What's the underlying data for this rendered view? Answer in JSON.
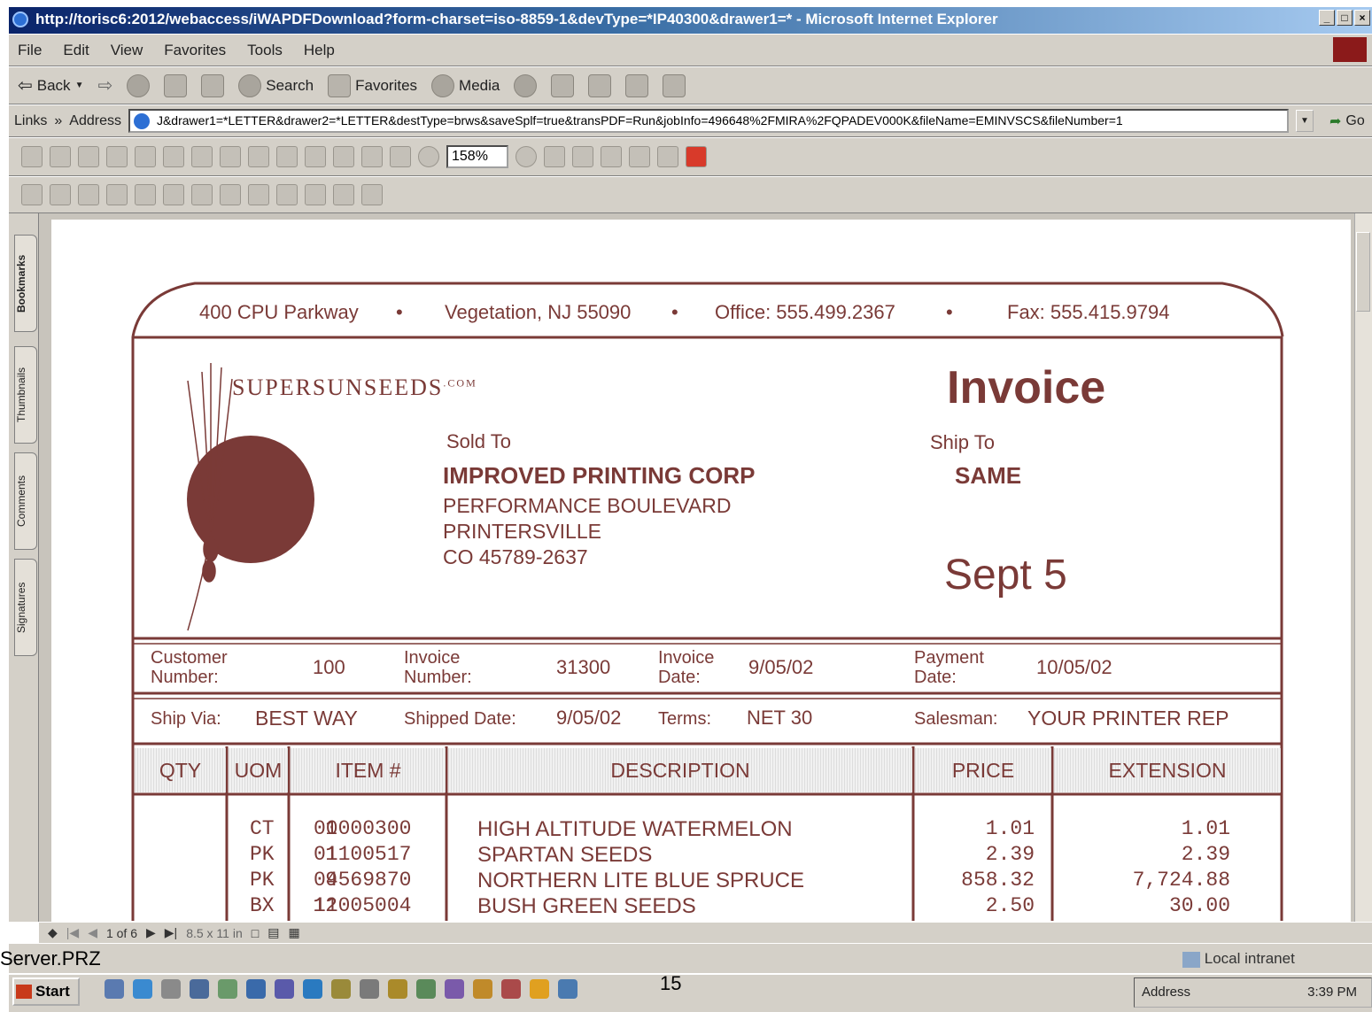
{
  "window": {
    "title": "http://torisc6:2012/webaccess/iWAPDFDownload?form-charset=iso-8859-1&devType=*IP40300&drawer1=* - Microsoft Internet Explorer",
    "buttons": [
      "_",
      "□",
      "×"
    ]
  },
  "menu": [
    "File",
    "Edit",
    "View",
    "Favorites",
    "Tools",
    "Help"
  ],
  "toolbar": {
    "back": "Back",
    "search": "Search",
    "favorites": "Favorites",
    "media": "Media"
  },
  "address": {
    "links_label": "Links",
    "chevron": "»",
    "label": "Address",
    "value": "J&drawer1=*LETTER&drawer2=*LETTER&destType=brws&saveSplf=true&transPDF=Run&jobInfo=496648%2FMIRA%2FQPADEV000K&fileName=EMINVSCS&fileNumber=1",
    "go": "Go"
  },
  "acrobat": {
    "zoom": "158%",
    "tabs": [
      "Bookmarks",
      "Thumbnails",
      "Comments",
      "Signatures"
    ],
    "page_indicator": "1 of 6",
    "page_size": "8.5 x 11 in"
  },
  "invoice": {
    "header_address": "400 CPU Parkway",
    "header_city": "Vegetation, NJ 55090",
    "header_office": "Office:  555.499.2367",
    "header_fax": "Fax:  555.415.9794",
    "bullet": "•",
    "logo_text": "SUPERSUNSEEDS",
    "logo_suffix": ".COM",
    "title": "Invoice",
    "sold_to_label": "Sold To",
    "sold_to_name": "IMPROVED PRINTING CORP",
    "sold_to_line1": "PERFORMANCE BOULEVARD",
    "sold_to_line2": "PRINTERSVILLE",
    "sold_to_line3": "CO  45789-2637",
    "ship_to_label": "Ship To",
    "ship_to_value": "SAME",
    "date_large": "Sept 5",
    "customer_number_label_1": "Customer",
    "customer_number_label_2": "Number:",
    "customer_number": "100",
    "invoice_number_label_1": "Invoice",
    "invoice_number_label_2": "Number:",
    "invoice_number": "31300",
    "invoice_date_label_1": "Invoice",
    "invoice_date_label_2": "Date:",
    "invoice_date": "9/05/02",
    "payment_date_label_1": "Payment",
    "payment_date_label_2": "Date:",
    "payment_date": "10/05/02",
    "ship_via_label": "Ship Via:",
    "ship_via": "BEST WAY",
    "shipped_date_label": "Shipped Date:",
    "shipped_date": "9/05/02",
    "terms_label": "Terms:",
    "terms": "NET 30",
    "salesman_label": "Salesman:",
    "salesman": "YOUR PRINTER REP",
    "columns": [
      "QTY",
      "UOM",
      "ITEM #",
      "DESCRIPTION",
      "PRICE",
      "EXTENSION"
    ],
    "rows": [
      {
        "qty": "1",
        "uom": "CT",
        "item": "00000300",
        "desc": "HIGH ALTITUDE WATERMELON",
        "price": "1.01",
        "ext": "1.01"
      },
      {
        "qty": "1",
        "uom": "PK",
        "item": "01100517",
        "desc": "SPARTAN SEEDS",
        "price": "2.39",
        "ext": "2.39"
      },
      {
        "qty": "9",
        "uom": "PK",
        "item": "04569870",
        "desc": "NORTHERN LITE BLUE SPRUCE",
        "price": "858.32",
        "ext": "7,724.88"
      },
      {
        "qty": "12",
        "uom": "BX",
        "item": "11005004",
        "desc": "BUSH GREEN SEEDS",
        "price": "2.50",
        "ext": "30.00"
      }
    ]
  },
  "statusbar": {
    "left": "Server.PRZ",
    "zone": "Local intranet"
  },
  "taskbar": {
    "start": "Start",
    "slide_number": "15",
    "address_label": "Address",
    "clock": "3:39 PM"
  },
  "colors": {
    "invoice_brown": "#7a3a37",
    "titlebar_blue": "#0a246a",
    "chrome_gray": "#d4d0c8"
  }
}
